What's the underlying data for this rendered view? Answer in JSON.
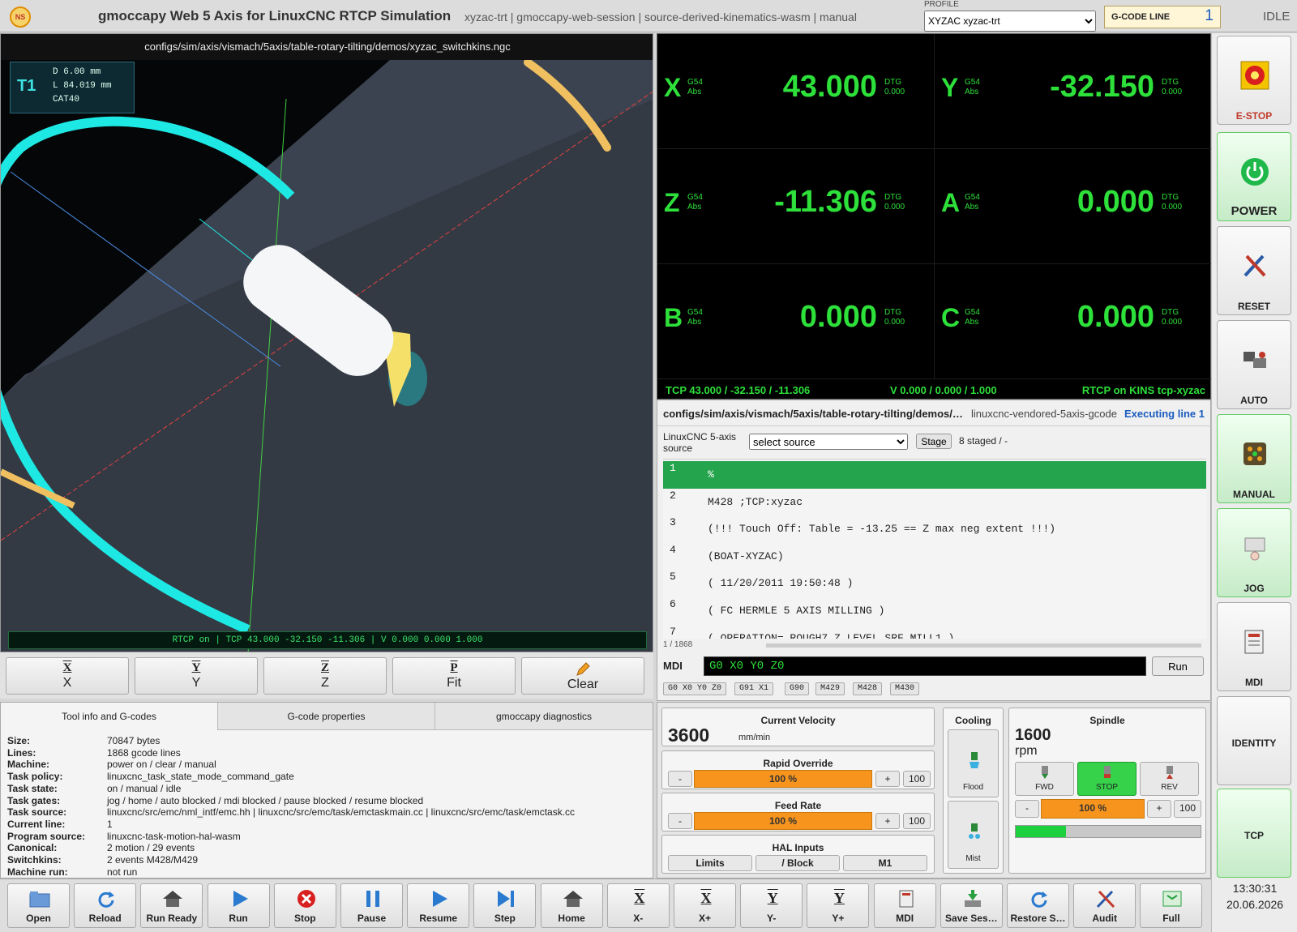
{
  "header": {
    "logo": "NS",
    "title": "gmoccapy Web 5 Axis for LinuxCNC RTCP Simulation",
    "subtitle": "xyzac-trt | gmoccapy-web-session | source-derived-kinematics-wasm | manual",
    "profile_label": "PROFILE",
    "profile_value": "XYZAC xyzac-trt",
    "gcode_line_label": "G-CODE LINE",
    "gcode_line_value": "1",
    "state": "IDLE"
  },
  "viewport": {
    "file_path": "configs/sim/axis/vismach/5axis/table-rotary-tilting/demos/xyzac_switchkins.ngc",
    "tool": {
      "number": "T1",
      "diameter": "D 6.00 mm",
      "length": "L 84.019 mm",
      "holder": "CAT40"
    },
    "status": "RTCP on | TCP 43.000 -32.150 -11.306 | V 0.000 0.000 1.000",
    "colors": {
      "ring": "#1ee8e4",
      "arc": "#f0c060",
      "tool": "#f4f6f8",
      "x_axis": "#e84040",
      "y_axis": "#40d040",
      "z_axis": "#4a90e8"
    }
  },
  "view_buttons": [
    {
      "icon": "X",
      "label": "X"
    },
    {
      "icon": "Y",
      "label": "Y"
    },
    {
      "icon": "Z",
      "label": "Z"
    },
    {
      "icon": "P",
      "label": "Fit"
    },
    {
      "icon": "pencil",
      "label": "Clear"
    }
  ],
  "dro": {
    "axes": [
      {
        "axis": "X",
        "coord": "G54",
        "mode": "Abs",
        "value": "43.000",
        "dtg_label": "DTG",
        "dtg": "0.000"
      },
      {
        "axis": "Y",
        "coord": "G54",
        "mode": "Abs",
        "value": "-32.150",
        "dtg_label": "DTG",
        "dtg": "0.000"
      },
      {
        "axis": "Z",
        "coord": "G54",
        "mode": "Abs",
        "value": "-11.306",
        "dtg_label": "DTG",
        "dtg": "0.000"
      },
      {
        "axis": "A",
        "coord": "G54",
        "mode": "Abs",
        "value": "0.000",
        "dtg_label": "DTG",
        "dtg": "0.000"
      },
      {
        "axis": "B",
        "coord": "G54",
        "mode": "Abs",
        "value": "0.000",
        "dtg_label": "DTG",
        "dtg": "0.000"
      },
      {
        "axis": "C",
        "coord": "G54",
        "mode": "Abs",
        "value": "0.000",
        "dtg_label": "DTG",
        "dtg": "0.000"
      }
    ],
    "tcp": "TCP 43.000 / -32.150 / -11.306",
    "vector": "V 0.000 / 0.000 / 1.000",
    "rtcp": "RTCP on  KINS tcp-xyzac",
    "color": "#2de03a"
  },
  "gcode": {
    "file": "configs/sim/axis/vismach/5axis/table-rotary-tilting/demos/xyzac_switchkins.ngc",
    "source": "linuxcnc-vendored-5axis-gcode",
    "executing": "Executing line 1",
    "source_label": "LinuxCNC 5-axis source",
    "source_select": "select source",
    "stage_label": "Stage",
    "staged": "8 staged / -",
    "lines": [
      {
        "n": "1",
        "text": "%"
      },
      {
        "n": "2",
        "text": "M428 ;TCP:xyzac"
      },
      {
        "n": "3",
        "text": "(!!! Touch Off: Table = -13.25 == Z max neg extent !!!)"
      },
      {
        "n": "4",
        "text": "(BOAT-XYZAC)"
      },
      {
        "n": "5",
        "text": "( 11/20/2011 19:50:48 )"
      },
      {
        "n": "6",
        "text": "( FC HERMLE 5 AXIS MILLING )"
      },
      {
        "n": "7",
        "text": "( OPERATION= ROUGH7 Z LEVEL SRF MILL1 )"
      }
    ],
    "position": "1 / 1868",
    "mdi_label": "MDI",
    "mdi_value": "G0 X0 Y0 Z0",
    "mdi_run": "Run",
    "history": [
      "G0 X0 Y0 Z0",
      "G91 X1",
      "G90",
      "M429",
      "M428",
      "M430"
    ]
  },
  "info": {
    "tabs": [
      "Tool info and G-codes",
      "G-code properties",
      "gmoccapy diagnostics"
    ],
    "rows": [
      {
        "k": "Size:",
        "v": "70847 bytes"
      },
      {
        "k": "Lines:",
        "v": "1868 gcode lines"
      },
      {
        "k": "Machine:",
        "v": "power on / clear / manual"
      },
      {
        "k": "Task policy:",
        "v": "linuxcnc_task_state_mode_command_gate"
      },
      {
        "k": "Task state:",
        "v": "on / manual / idle"
      },
      {
        "k": "Task gates:",
        "v": "jog / home / auto blocked / mdi blocked / pause blocked / resume blocked"
      },
      {
        "k": "Task source:",
        "v": "linuxcnc/src/emc/nml_intf/emc.hh | linuxcnc/src/emc/task/emctaskmain.cc | linuxcnc/src/emc/task/emctask.cc"
      },
      {
        "k": "Current line:",
        "v": "1"
      },
      {
        "k": "Program source:",
        "v": "linuxcnc-task-motion-hal-wasm"
      },
      {
        "k": "Canonical:",
        "v": "2 motion / 29 events"
      },
      {
        "k": "Switchkins:",
        "v": "2 events M428/M429"
      },
      {
        "k": "Machine run:",
        "v": "not run"
      }
    ]
  },
  "controls": {
    "velocity": {
      "title": "Current Velocity",
      "value": "3600",
      "unit": "mm/min"
    },
    "rapid": {
      "title": "Rapid Override",
      "minus": "-",
      "value": "100 %",
      "percent": 100,
      "plus": "+",
      "preset": "100"
    },
    "feed": {
      "title": "Feed Rate",
      "minus": "-",
      "value": "100 %",
      "percent": 100,
      "plus": "+",
      "preset": "100"
    },
    "hal": {
      "title": "HAL Inputs",
      "buttons": [
        "Limits",
        "/ Block",
        "M1"
      ]
    },
    "cooling": {
      "title": "Cooling",
      "flood": "Flood",
      "mist": "Mist"
    },
    "spindle": {
      "title": "Spindle",
      "speed": "1600",
      "unit": "rpm",
      "fwd": "FWD",
      "stop": "STOP",
      "rev": "REV",
      "minus": "-",
      "override": "100 %",
      "override_percent": 100,
      "plus": "+",
      "preset": "100",
      "load_fraction": 0.27
    }
  },
  "sidebar": [
    {
      "label": "E-STOP",
      "icon": "estop-icon"
    },
    {
      "label": "POWER",
      "icon": "power-icon"
    },
    {
      "label": "RESET",
      "icon": "reset-icon"
    },
    {
      "label": "AUTO",
      "icon": "auto-icon"
    },
    {
      "label": "MANUAL",
      "icon": "manual-icon"
    },
    {
      "label": "JOG",
      "icon": "jog-icon"
    },
    {
      "label": "MDI",
      "icon": "mdi-icon"
    },
    {
      "label": "IDENTITY",
      "icon": ""
    },
    {
      "label": "TCP",
      "icon": ""
    }
  ],
  "clock": {
    "time": "13:30:31",
    "date": "20.06.2026"
  },
  "toolbar": [
    {
      "label": "Open",
      "icon": "folder-icon"
    },
    {
      "label": "Reload",
      "icon": "reload-icon"
    },
    {
      "label": "Run Ready",
      "icon": "home-icon"
    },
    {
      "label": "Run",
      "icon": "play-icon"
    },
    {
      "label": "Stop",
      "icon": "stop-icon"
    },
    {
      "label": "Pause",
      "icon": "pause-icon"
    },
    {
      "label": "Resume",
      "icon": "play-icon"
    },
    {
      "label": "Step",
      "icon": "step-icon"
    },
    {
      "label": "Home",
      "icon": "home-icon"
    },
    {
      "label": "X-",
      "icon": "X"
    },
    {
      "label": "X+",
      "icon": "X"
    },
    {
      "label": "Y-",
      "icon": "Y"
    },
    {
      "label": "Y+",
      "icon": "Y"
    },
    {
      "label": "MDI",
      "icon": "mdi-icon"
    },
    {
      "label": "Save Ses…",
      "icon": "save-icon"
    },
    {
      "label": "Restore S…",
      "icon": "reload-icon"
    },
    {
      "label": "Audit",
      "icon": "audit-icon"
    },
    {
      "label": "Full",
      "icon": "fullscreen-icon"
    }
  ]
}
